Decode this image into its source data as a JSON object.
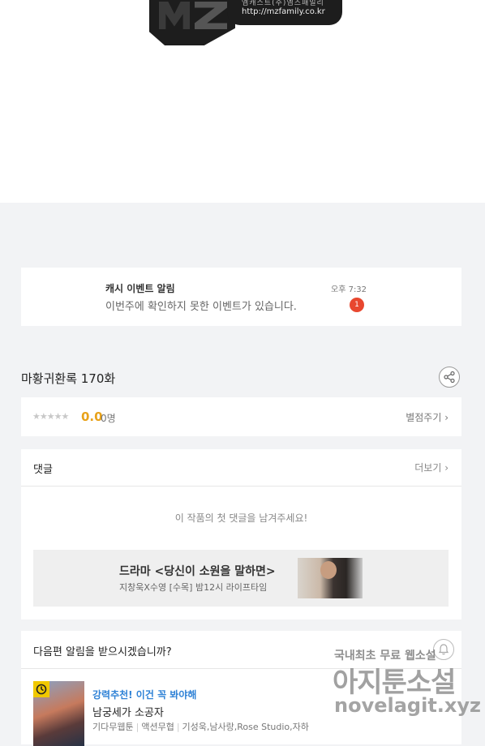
{
  "logo": {
    "company": "엠캐스트(주)엠즈패밀리",
    "url": "http://mzfamily.co.kr"
  },
  "notification": {
    "title": "캐시 이벤트 알림",
    "message": "이번주에 확인하지 못한 이벤트가 있습니다.",
    "time": "오후 7:32",
    "badge_count": "1",
    "badge_color": "#e8472f"
  },
  "episode": {
    "title": "마황귀환록 170화",
    "share_icon": "share-icon"
  },
  "rating": {
    "stars": "★★★★★",
    "score": "0.0",
    "count": "0명",
    "rate_label": "별점주기 ›",
    "score_color": "#e8a21a"
  },
  "comments": {
    "label": "댓글",
    "more_label": "더보기 ›",
    "empty_message": "이 작품의 첫 댓글을 남겨주세요!"
  },
  "ad": {
    "title": "드라마 <당신이 소원을 말하면>",
    "subtitle": "지창욱X수영 [수목] 밤12시 라이프타임"
  },
  "next_episode": {
    "question": "다음편 알림을 받으시겠습니까?",
    "bell_icon": "bell-icon",
    "recommend_label": "강력추천! 이건 꼭 봐야해",
    "recommend_color": "#2f82d6",
    "work_title": "남궁세가 소공자",
    "meta": [
      "기다무웹툰",
      "액션무협",
      "기성욱,남사랑,Rose Studio,자하"
    ]
  },
  "watermark": {
    "line1": "국내최초 무료 웹소설",
    "line2": "아지툰소설",
    "line3": "novelagit.xyz"
  }
}
